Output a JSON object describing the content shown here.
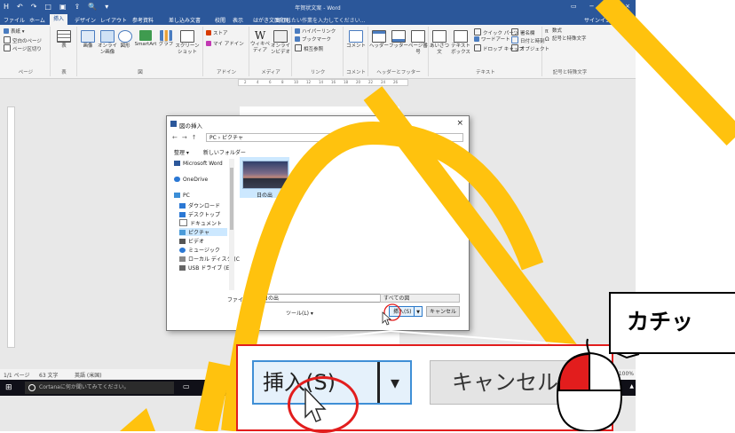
{
  "titlebar": {
    "qat": [
      "H",
      "↶",
      "↷",
      "□",
      "▣",
      "⇪",
      "🔍",
      "▾"
    ],
    "title": "年賀状文案 - Word",
    "win": [
      "▭",
      "−",
      "□",
      "×"
    ]
  },
  "tabs": {
    "items": [
      "ファイル",
      "ホーム",
      "挿入",
      "デザイン",
      "レイアウト",
      "参考資料",
      "差し込み文書",
      "校閲",
      "表示",
      "はがき文面印刷"
    ],
    "active_index": 2,
    "tellme": "実行したい作業を入力してください...",
    "signin": "サインイン",
    "share": "共有"
  },
  "ribbon": {
    "pages": {
      "items": [
        "表紙 ▾",
        "空白のページ",
        "ページ区切り"
      ],
      "label": "ページ"
    },
    "table": {
      "btn": "表",
      "label": "表"
    },
    "illust": {
      "items": [
        "画像",
        "オンライン画像",
        "図形",
        "SmartArt",
        "グラフ",
        "スクリーンショット"
      ],
      "label": "図"
    },
    "addins": {
      "items": [
        "ストア",
        "マイ アドイン"
      ],
      "label": "アドイン"
    },
    "media": {
      "items": [
        "ウィキペディア",
        "オンラインビデオ"
      ],
      "label": "メディア"
    },
    "links": {
      "items": [
        "ハイパーリンク",
        "ブックマーク",
        "相互参照"
      ],
      "label": "リンク"
    },
    "comment": {
      "btn": "コメント",
      "label": "コメント"
    },
    "hf": {
      "items": [
        "ヘッダー",
        "フッター",
        "ページ番号"
      ],
      "label": "ヘッダーとフッター"
    },
    "text": {
      "items": [
        "あいさつ文",
        "テキストボックス",
        "クイック パーツ",
        "ワードアート",
        "ドロップ キャップ",
        "署名欄",
        "日付と時刻",
        "オブジェクト"
      ],
      "label": "テキスト"
    },
    "symbols": {
      "items": [
        "数式",
        "記号と特殊文字"
      ],
      "label": "記号と特殊文字"
    }
  },
  "ruler": [
    "2",
    "4",
    "6",
    "8",
    "10",
    "12",
    "14",
    "16",
    "18",
    "20",
    "22",
    "24",
    "26"
  ],
  "status": {
    "page": "1/1 ページ",
    "words": "63 文字",
    "lang": "英語 (米国)",
    "zoom": "100%"
  },
  "taskbar": {
    "search": "Cortanaに何か聞いてみてください。"
  },
  "dialog": {
    "title": "図の挿入",
    "path": "PC › ピクチャ",
    "search_placeholder": "ピクチャの検索",
    "organize": "整理 ▾",
    "new_folder": "新しいフォルダー",
    "nav": [
      "Microsoft Word",
      "OneDrive",
      "PC",
      "ダウンロード",
      "デスクトップ",
      "ドキュメント",
      "ピクチャ",
      "ビデオ",
      "ミュージック",
      "ローカル ディスク (C",
      "USB ドライブ (E:)"
    ],
    "selected_nav": 6,
    "file_name": "日の出",
    "file_label": "ファイル名(N):",
    "file_value": "日の出",
    "filter": "すべての図",
    "tools": "ツール(L) ▾",
    "insert": "挿入(S)",
    "cancel": "キャンセル"
  },
  "zoom": {
    "insert": "挿入(S)",
    "dropdown": "▾",
    "cancel": "キャンセル"
  },
  "bubble": "カチッ",
  "colors": {
    "word_blue": "#2b579a",
    "highlight_yellow": "#ffc20e",
    "red": "#e21d1d"
  }
}
